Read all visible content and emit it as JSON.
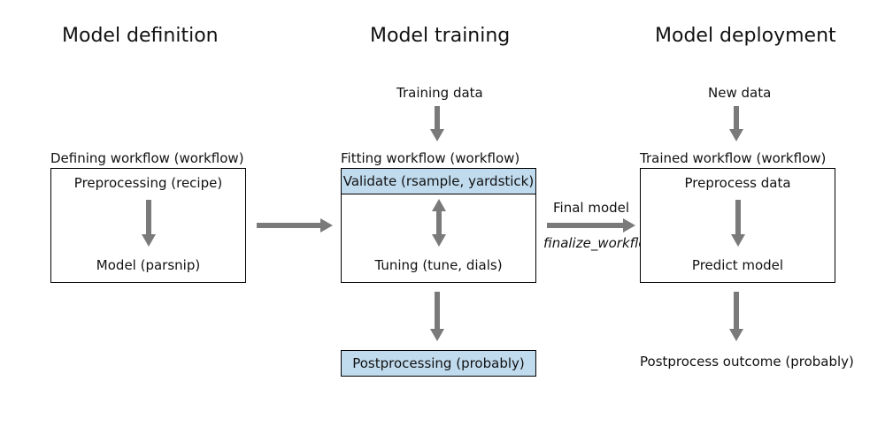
{
  "headers": {
    "definition": "Model definition",
    "training": "Model training",
    "deployment": "Model deployment"
  },
  "definition": {
    "box_label": "Defining workflow (workflow)",
    "preprocessing": "Preprocessing (recipe)",
    "model": "Model (parsnip)"
  },
  "training": {
    "input": "Training data",
    "box_label": "Fitting workflow (workflow)",
    "validate": "Validate (rsample, yardstick)",
    "tuning": "Tuning (tune, dials)",
    "postprocessing": "Postprocessing (probably)"
  },
  "deployment": {
    "input": "New data",
    "box_label": "Trained workflow (workflow)",
    "preprocess": "Preprocess data",
    "predict": "Predict model",
    "postprocess": "Postprocess outcome (probably)"
  },
  "edge": {
    "final_model": "Final model",
    "finalize_fn": "finalize_workflow"
  },
  "colors": {
    "highlight": "#c1dbee",
    "arrow": "#7a7a7a"
  }
}
